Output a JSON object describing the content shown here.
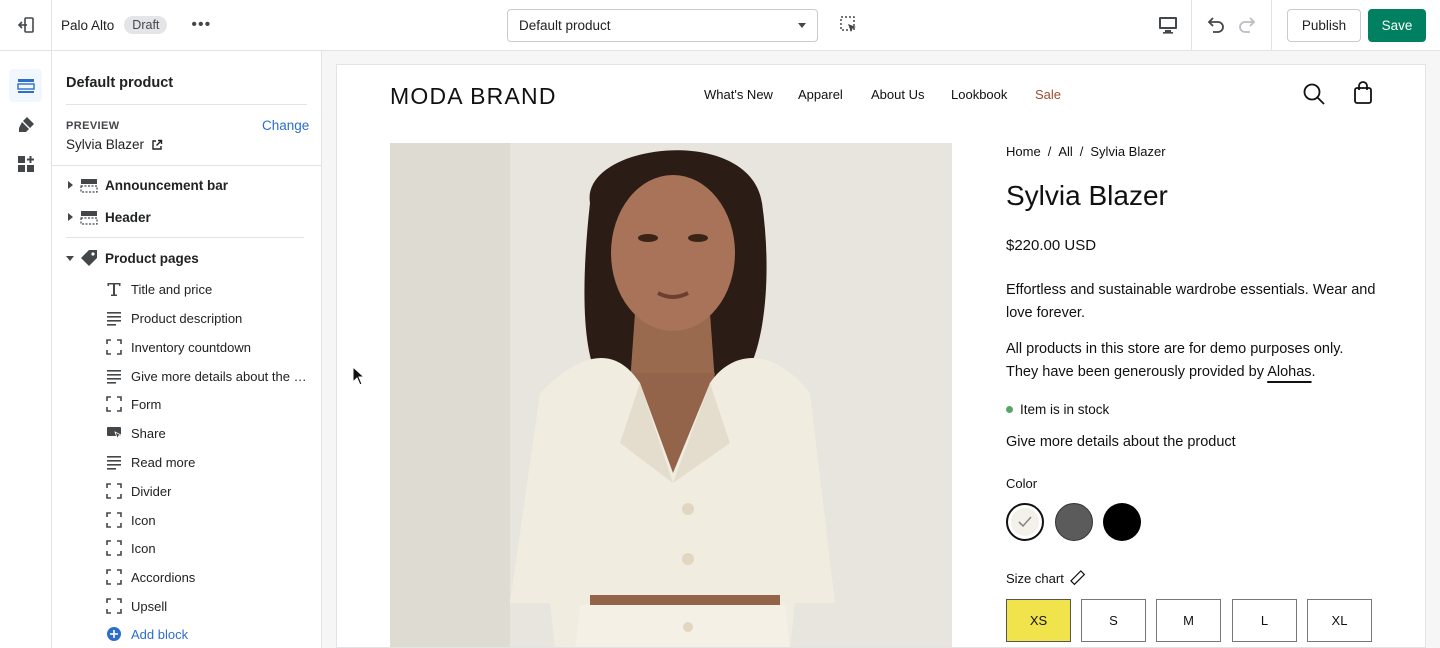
{
  "topbar": {
    "theme_name": "Palo Alto",
    "status_badge": "Draft",
    "more": "•••",
    "template_select_value": "Default product",
    "publish_label": "Publish",
    "save_label": "Save"
  },
  "rail": {
    "items": [
      "sections-icon",
      "theme-settings-icon",
      "app-embeds-icon"
    ]
  },
  "sidebar": {
    "title": "Default product",
    "preview_label": "PREVIEW",
    "change_label": "Change",
    "preview_product": "Sylvia Blazer",
    "sections": [
      {
        "label": "Announcement bar",
        "expanded": false
      },
      {
        "label": "Header",
        "expanded": false
      },
      {
        "label": "Product pages",
        "expanded": true
      }
    ],
    "blocks": [
      {
        "label": "Title and price",
        "icon": "text-icon"
      },
      {
        "label": "Product description",
        "icon": "lines-icon"
      },
      {
        "label": "Inventory countdown",
        "icon": "block-frame-icon"
      },
      {
        "label": "Give more details about the product",
        "icon": "lines-icon"
      },
      {
        "label": "Form",
        "icon": "block-frame-icon"
      },
      {
        "label": "Share",
        "icon": "share-icon"
      },
      {
        "label": "Read more",
        "icon": "lines-icon"
      },
      {
        "label": "Divider",
        "icon": "block-frame-icon"
      },
      {
        "label": "Icon",
        "icon": "block-frame-icon"
      },
      {
        "label": "Icon",
        "icon": "block-frame-icon"
      },
      {
        "label": "Accordions",
        "icon": "block-frame-icon"
      },
      {
        "label": "Upsell",
        "icon": "block-frame-icon"
      }
    ],
    "add_block_label": "Add block"
  },
  "store": {
    "brand": "MODA BRAND",
    "nav": [
      "What's New",
      "Apparel",
      "About Us",
      "Lookbook",
      "Sale"
    ],
    "breadcrumb": [
      "Home",
      "All",
      "Sylvia Blazer"
    ],
    "breadcrumb_separator": "/",
    "product_title": "Sylvia Blazer",
    "price": "$220.00 USD",
    "description": "Effortless and sustainable wardrobe essentials. Wear and love forever.",
    "demo_note_prefix": "All products in this store are for demo purposes only. They have been generously provided by ",
    "demo_note_link": "Alohas",
    "demo_note_suffix": ".",
    "stock": "Item is in stock",
    "details": "Give more details about the product",
    "color_label": "Color",
    "colors": [
      "#f4f1ea",
      "#5b5b5b",
      "#000000"
    ],
    "size_chart_label": "Size chart",
    "sizes": [
      "XS",
      "S",
      "M",
      "L",
      "XL"
    ],
    "selected_size": "XS",
    "accent_color": "#f0e34b",
    "sale_color": "#9b4d2e",
    "save_color": "#008060"
  }
}
